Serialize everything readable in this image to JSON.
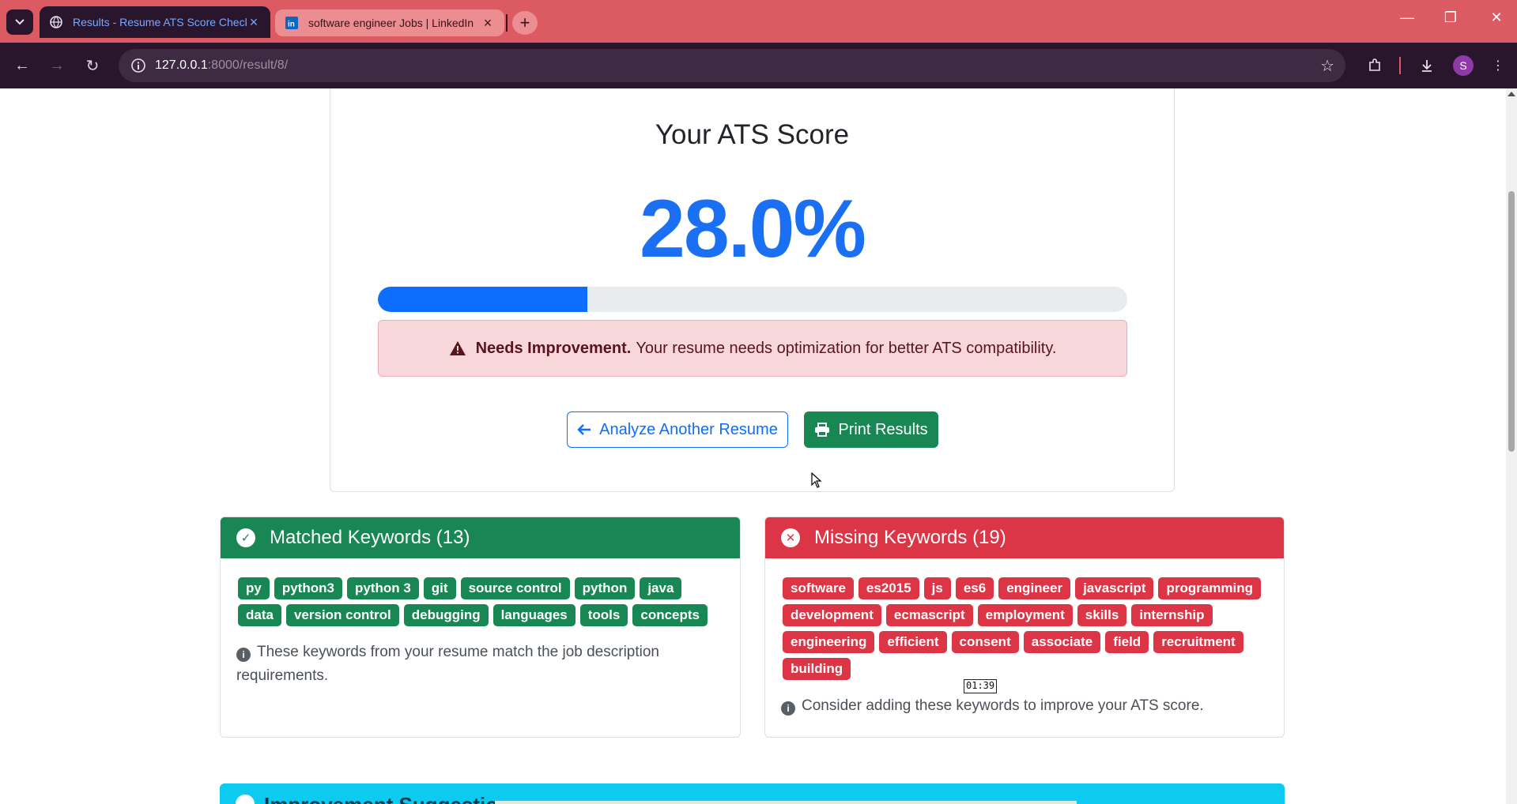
{
  "browser": {
    "tabs": [
      {
        "title": "Results - Resume ATS Score Checker",
        "active": true,
        "favicon": "globe-icon"
      },
      {
        "title": "software engineer Jobs | LinkedIn",
        "active": false,
        "favicon": "linkedin-icon"
      }
    ],
    "url_host": "127.0.0.1",
    "url_path": ":8000/result/8/",
    "profile_initial": "S",
    "theme_color": "#dc5b62"
  },
  "score": {
    "heading": "Your ATS Score",
    "value_text": "28.0%",
    "percent": 28.0,
    "alert_strong": "Needs Improvement.",
    "alert_text": "Your resume needs optimization for better ATS compatibility.",
    "analyze_label": "Analyze Another Resume",
    "print_label": "Print Results"
  },
  "matched": {
    "title": "Matched Keywords (13)",
    "keywords": [
      "py",
      "python3",
      "python 3",
      "git",
      "source control",
      "python",
      "java",
      "data",
      "version control",
      "debugging",
      "languages",
      "tools",
      "concepts"
    ],
    "note": "These keywords from your resume match the job description requirements.",
    "color": "#198754"
  },
  "missing": {
    "title": "Missing Keywords (19)",
    "keywords": [
      "software",
      "es2015",
      "js",
      "es6",
      "engineer",
      "javascript",
      "programming",
      "development",
      "ecmascript",
      "employment",
      "skills",
      "internship",
      "engineering",
      "efficient",
      "consent",
      "associate",
      "field",
      "recruitment",
      "building"
    ],
    "note": "Consider adding these keywords to improve your ATS score.",
    "color": "#dc3545"
  },
  "suggestions": {
    "title": "Improvement Suggestions"
  },
  "overlay": {
    "timer": "01:39"
  }
}
